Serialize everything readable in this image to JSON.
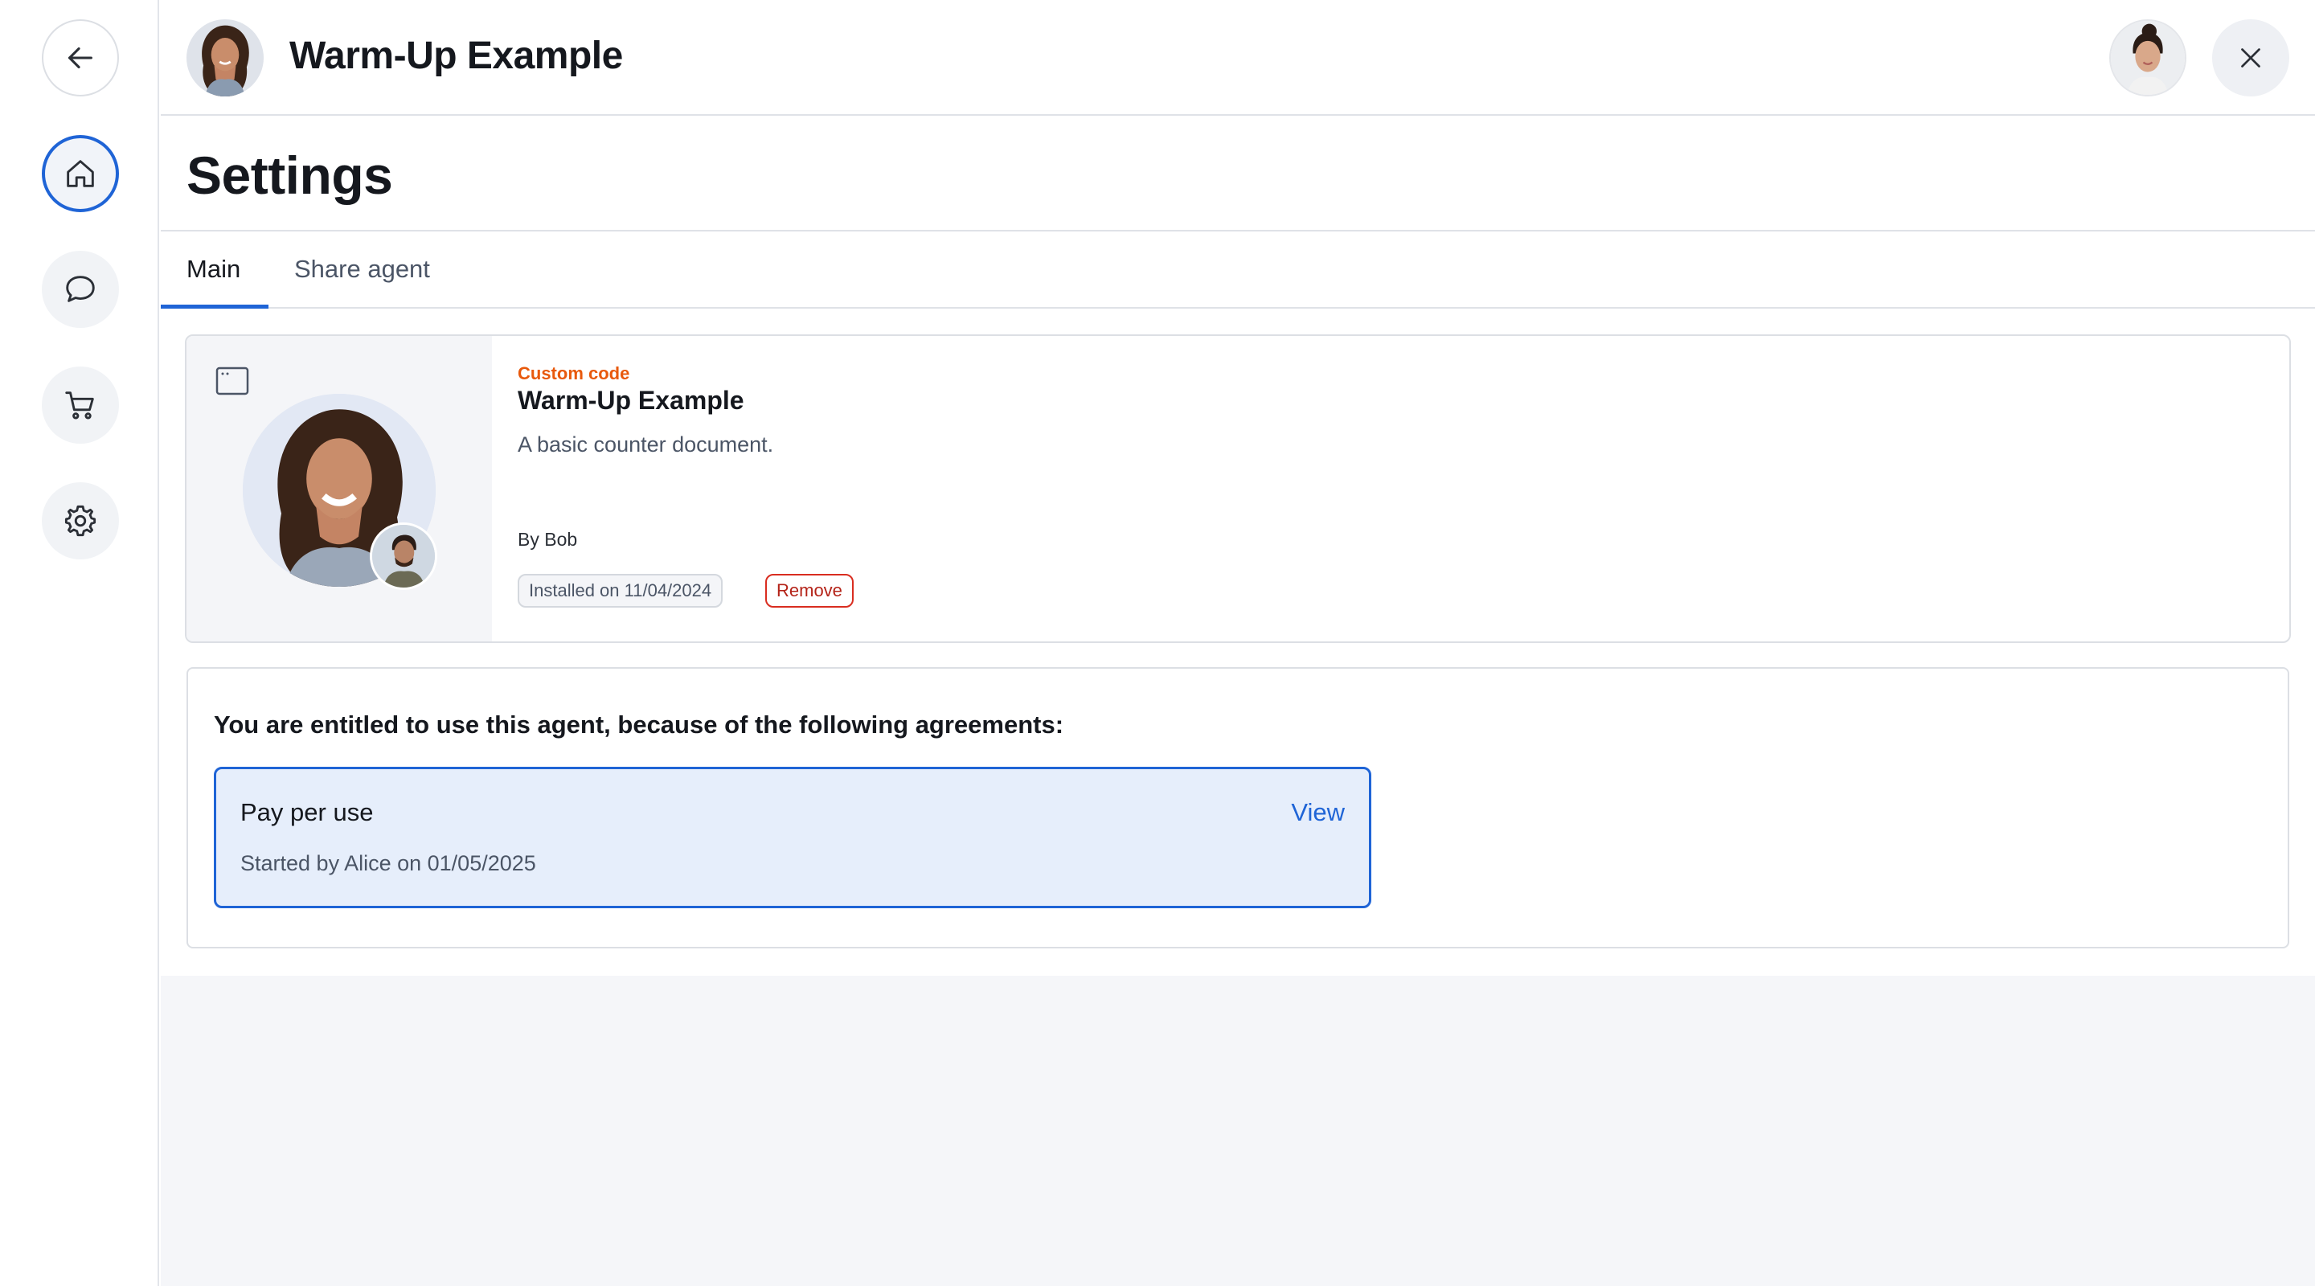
{
  "header": {
    "app_title": "Warm-Up Example"
  },
  "sidebar": {
    "items": [
      {
        "name": "back",
        "icon": "arrow-left-icon"
      },
      {
        "name": "home",
        "icon": "home-icon",
        "active": true
      },
      {
        "name": "chat",
        "icon": "chat-icon"
      },
      {
        "name": "store",
        "icon": "cart-icon"
      },
      {
        "name": "settings",
        "icon": "gear-icon"
      }
    ]
  },
  "page": {
    "title": "Settings",
    "tabs": [
      {
        "label": "Main",
        "active": true
      },
      {
        "label": "Share agent",
        "active": false
      }
    ]
  },
  "agent": {
    "kind": "Custom code",
    "name": "Warm-Up Example",
    "description": "A basic counter document.",
    "author": "By Bob",
    "installed": "Installed on 11/04/2024",
    "remove_label": "Remove"
  },
  "entitlements": {
    "heading": "You are entitled to use this agent, because of the following agreements:",
    "agreements": [
      {
        "name": "Pay per use",
        "view_label": "View",
        "meta": "Started by Alice on 01/05/2025"
      }
    ]
  },
  "colors": {
    "accent": "#1f64d6",
    "kind_label": "#e8590c",
    "danger": "#d92d20",
    "agreement_bg": "#e6eefb"
  }
}
